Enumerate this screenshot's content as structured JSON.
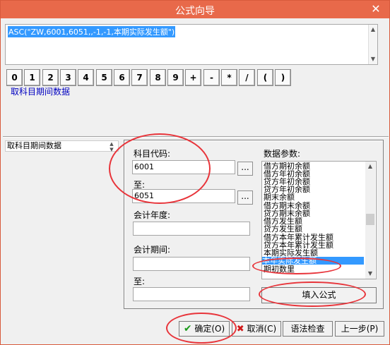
{
  "window": {
    "title": "公式向导",
    "close_glyph": "✕"
  },
  "formula": {
    "text": "ASC(\"ZW,6001,6051,,-1,-1,本期实际发生额\")"
  },
  "keypad": {
    "keys": [
      "0",
      "1",
      "2",
      "3",
      "4",
      "5",
      "6",
      "7",
      "8",
      "9",
      "+",
      "-",
      "*",
      "/",
      "(",
      ")"
    ]
  },
  "function_description": "取科目期间数据",
  "function_list": {
    "selected": "取科目期间数据"
  },
  "params": {
    "account_code_label": "科目代码:",
    "account_code_value": "6001",
    "to_label": "至:",
    "to_value": "6051",
    "fiscal_year_label": "会计年度:",
    "fiscal_year_value": "",
    "period_label": "会计期间:",
    "period_value": "",
    "period_to_label": "至:",
    "period_to_value": "",
    "browse_label": "...",
    "data_param_label": "数据参数:",
    "data_param_items": [
      "借方期初余额",
      "借方年初余额",
      "贷方年初余额",
      "贷方年初余额",
      "期末余额",
      "借方期末余额",
      "贷方期末余额",
      "借方发生额",
      "贷方发生额",
      "借方本年累计发生额",
      "贷方本年累计发生额",
      "本期实际发生额",
      "本年实际发生额",
      "期初数里"
    ],
    "selected_item": "本年实际发生额",
    "insert_formula_label": "填入公式"
  },
  "footer": {
    "ok_label": "确定(O)",
    "cancel_label": "取消(C)",
    "syntax_label": "语法检查",
    "prev_label": "上一步(P)"
  },
  "colors": {
    "titlebar": "#e8694a",
    "selection": "#3399ff",
    "annotation": "#e8343a",
    "ok_check": "#1a9a1a",
    "cancel_x": "#d01818"
  }
}
